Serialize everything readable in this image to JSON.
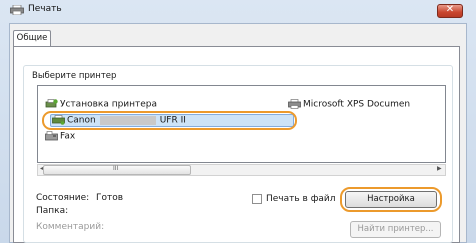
{
  "window": {
    "title": "Печать"
  },
  "tabs": [
    {
      "label": "Общие"
    }
  ],
  "printer_group": {
    "label": "Выберите принтер",
    "items": [
      {
        "label": "Установка принтера",
        "icon": "add-printer-icon"
      },
      {
        "label": "Microsoft XPS Documen",
        "icon": "printer-icon"
      },
      {
        "name_left": "Canon",
        "name_right": "UFR II",
        "icon": "printer-icon",
        "selected": true
      },
      {
        "label": "Fax",
        "icon": "fax-icon"
      }
    ],
    "scrollbar_grip": "III"
  },
  "status": {
    "label": "Состояние:",
    "value": "Готов"
  },
  "location": {
    "label": "Папка:"
  },
  "comment": {
    "label": "Комментарий:"
  },
  "print_to_file": {
    "label": "Печать в файл",
    "checked": false
  },
  "buttons": {
    "settings": "Настройка",
    "find_printer": "Найти принтер..."
  },
  "colors": {
    "highlight": "#ec9a2c",
    "close": "#c9462f"
  }
}
